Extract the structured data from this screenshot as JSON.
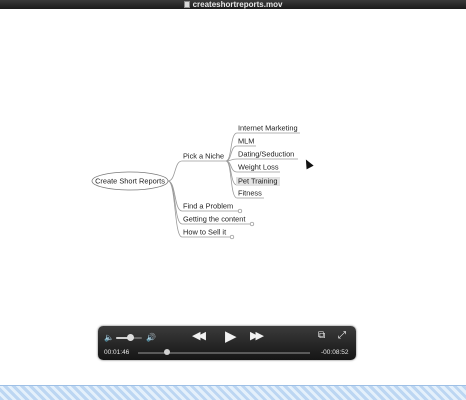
{
  "window": {
    "title": "createshortreports.mov"
  },
  "mindmap": {
    "root": "Create Short Reports",
    "branches": [
      {
        "label": "Pick a Niche"
      },
      {
        "label": "Find a Problem"
      },
      {
        "label": "Getting the content"
      },
      {
        "label": "How to Sell it"
      }
    ],
    "sub_branches": [
      {
        "label": "Internet Marketing"
      },
      {
        "label": "MLM"
      },
      {
        "label": "Dating/Seduction"
      },
      {
        "label": "Weight Loss"
      },
      {
        "label": "Pet Training"
      },
      {
        "label": "Fitness"
      }
    ]
  },
  "player": {
    "elapsed": "00:01:46",
    "remaining": "-00:08:52",
    "volume": 0.55,
    "progress": 0.17
  }
}
